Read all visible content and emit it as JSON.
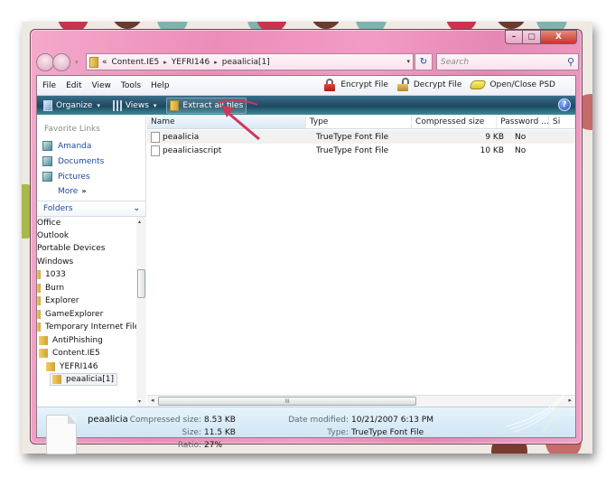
{
  "window": {
    "caption_buttons": {
      "minimize": "–",
      "maximize": "▢",
      "close": "X"
    }
  },
  "nav": {
    "back_icon": "back-arrow-icon",
    "forward_icon": "forward-arrow-icon",
    "history_dropdown": "▾",
    "address": {
      "prefix": "«",
      "segments": [
        "Content.IE5",
        "YEFRI146",
        "peaalicia[1]"
      ],
      "separator": "▸",
      "dropdown": "▾"
    },
    "refresh_label": "↻",
    "search": {
      "placeholder": "Search",
      "value": "",
      "icon": "⚲"
    }
  },
  "menubar": {
    "items": [
      "File",
      "Edit",
      "View",
      "Tools",
      "Help"
    ],
    "tools": [
      {
        "label": "Encrypt File",
        "icon": "lock-red-icon"
      },
      {
        "label": "Decrypt File",
        "icon": "lock-open-gold-icon"
      },
      {
        "label": "Open/Close PSD",
        "icon": "disk-icon"
      }
    ]
  },
  "commandbar": {
    "organize": "Organize",
    "views": "Views",
    "extract": "Extract all files",
    "dropdown": "▾",
    "help": "?"
  },
  "sidebar": {
    "favorites_title": "Favorite Links",
    "favorites": [
      "Amanda",
      "Documents",
      "Pictures"
    ],
    "more": "More",
    "more_glyph": "»",
    "folders_title": "Folders",
    "folders_chevron": "⌄",
    "tree": [
      {
        "label": "Office",
        "level": 0,
        "icon": "none"
      },
      {
        "label": "Outlook",
        "level": 0,
        "icon": "none"
      },
      {
        "label": "Portable Devices",
        "level": 0,
        "icon": "none"
      },
      {
        "label": "Windows",
        "level": 0,
        "icon": "none"
      },
      {
        "label": "1033",
        "level": 1,
        "icon": "folder"
      },
      {
        "label": "Burn",
        "level": 1,
        "icon": "folder"
      },
      {
        "label": "Explorer",
        "level": 1,
        "icon": "folder"
      },
      {
        "label": "GameExplorer",
        "level": 1,
        "icon": "folder"
      },
      {
        "label": "Temporary Internet Files",
        "level": 1,
        "icon": "folder"
      },
      {
        "label": "AntiPhishing",
        "level": 2,
        "icon": "folder"
      },
      {
        "label": "Content.IE5",
        "level": 2,
        "icon": "folder"
      },
      {
        "label": "YEFRI146",
        "level": 3,
        "icon": "folder"
      },
      {
        "label": "peaalicia[1]",
        "level": 4,
        "icon": "zip-folder",
        "selected": true
      }
    ],
    "scroll_up": "▴",
    "scroll_down": "▾"
  },
  "filelist": {
    "columns": [
      "Name",
      "Type",
      "Compressed size",
      "Password ...",
      "Si"
    ],
    "rows": [
      {
        "name": "peaalicia",
        "type": "TrueType Font File",
        "compressed_size": "9 KB",
        "password": "No"
      },
      {
        "name": "peaaliciascript",
        "type": "TrueType Font File",
        "compressed_size": "10 KB",
        "password": "No"
      }
    ],
    "hscroll": {
      "left": "◂",
      "right": "▸",
      "grip": "III"
    }
  },
  "details": {
    "name": "peaalicia",
    "fields": {
      "compressed_size_label": "Compressed size:",
      "compressed_size": "8.53 KB",
      "size_label": "Size:",
      "size": "11.5 KB",
      "ratio_label": "Ratio:",
      "ratio": "27%",
      "date_modified_label": "Date modified:",
      "date_modified": "10/21/2007 6:13 PM",
      "type_label": "Type:",
      "type": "TrueType Font File"
    }
  },
  "colors": {
    "window_frame": "#ec8db8",
    "command_bar": "#244f68",
    "link_blue": "#1e4aa0",
    "details_bg": "#cfe6f4"
  }
}
